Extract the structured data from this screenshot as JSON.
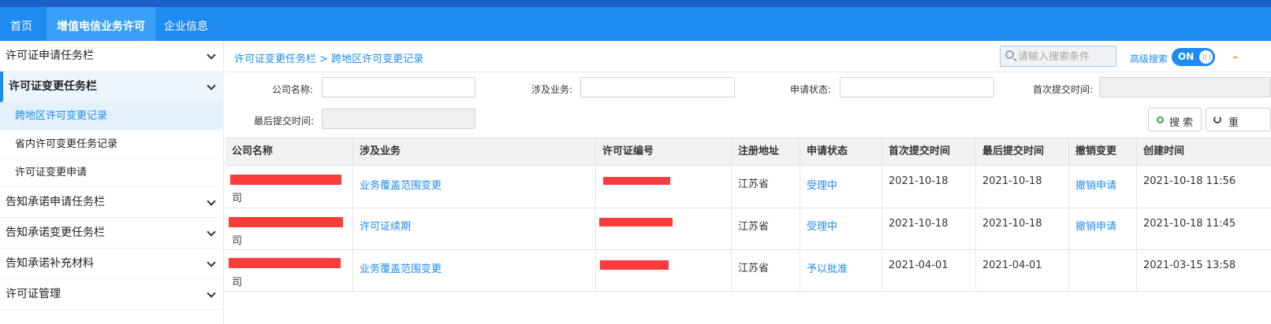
{
  "topnav": {
    "items": [
      {
        "label": "首页",
        "active": false
      },
      {
        "label": "增值电信业务许可",
        "active": true
      },
      {
        "label": "企业信息",
        "active": false
      }
    ]
  },
  "sidebar": {
    "groups": [
      {
        "label": "许可证申请任务栏"
      },
      {
        "label": "许可证变更任务栏",
        "active": true
      },
      {
        "label": "告知承诺申请任务栏"
      },
      {
        "label": "告知承诺变更任务栏"
      },
      {
        "label": "告知承诺补充材料"
      },
      {
        "label": "许可证管理"
      }
    ],
    "subitems": [
      {
        "label": "跨地区许可变更记录",
        "active": true
      },
      {
        "label": "省内许可变更任务记录"
      },
      {
        "label": "许可证变更申请"
      }
    ]
  },
  "breadcrumb": "许可证变更任务栏 > 跨地区许可变更记录",
  "search": {
    "placeholder": "请输入搜索条件"
  },
  "advanced": {
    "label": "高级搜索",
    "toggle": "ON"
  },
  "filters": {
    "company": "公司名称:",
    "business": "涉及业务:",
    "status": "申请状态:",
    "first_submit": "首次提交时间:",
    "last_submit": "最后提交时间:",
    "search_button": "搜 索",
    "reset_button": "重"
  },
  "table": {
    "headers": [
      "公司名称",
      "涉及业务",
      "许可证编号",
      "注册地址",
      "申请状态",
      "首次提交时间",
      "最后提交时间",
      "撤销变更",
      "创建时间"
    ],
    "rows": [
      {
        "company_suffix": "司",
        "business": "业务覆盖范围变更",
        "address": "江苏省",
        "status": "受理中",
        "first": "2021-10-18",
        "last": "2021-10-18",
        "revoke": "撤销申请",
        "created": "2021-10-18 11:56"
      },
      {
        "company_suffix": "司",
        "business": "许可证续期",
        "address": "江苏省",
        "status": "受理中",
        "first": "2021-10-18",
        "last": "2021-10-18",
        "revoke": "撤销申请",
        "created": "2021-10-18 11:45"
      },
      {
        "company_suffix": "司",
        "business": "业务覆盖范围变更",
        "address": "江苏省",
        "status": "予以批准",
        "first": "2021-04-01",
        "last": "2021-04-01",
        "revoke": "",
        "created": "2021-03-15 13:58"
      }
    ]
  },
  "colors": {
    "accent": "#1e8bf0",
    "redaction": "#fc3b3b"
  }
}
